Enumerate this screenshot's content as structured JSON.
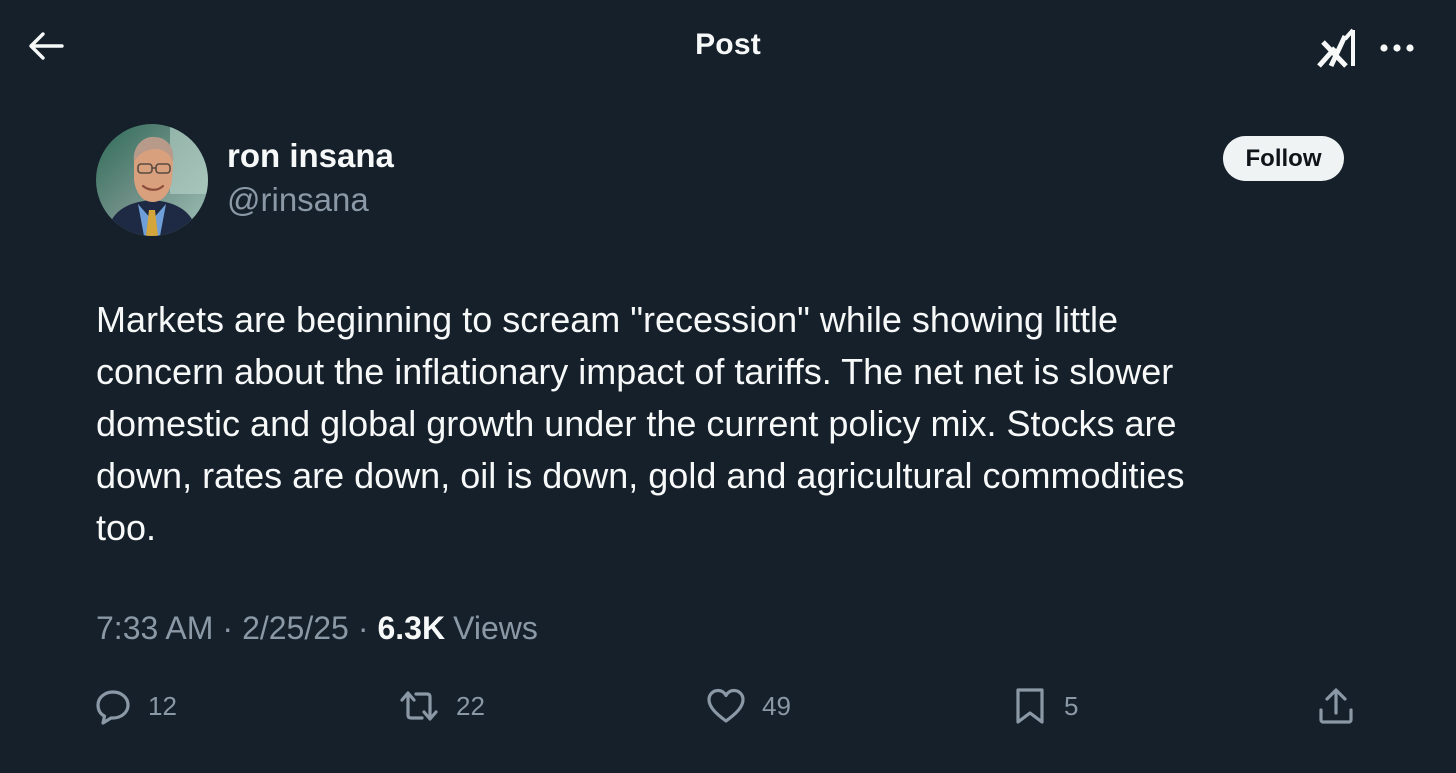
{
  "header": {
    "title": "Post",
    "back_icon": "arrow-left-icon",
    "grok_icon": "grok-logo-icon",
    "more_icon": "more-dots-icon"
  },
  "author": {
    "display_name": "ron insana",
    "handle": "@rinsana",
    "follow_label": "Follow"
  },
  "post": {
    "text": "Markets are beginning to scream \"recession\" while showing little\nconcern about the inflationary impact of tariffs. The net net is slower\ndomestic and global growth under the current policy mix. Stocks are\ndown, rates are down, oil is down, gold and agricultural commodities\ntoo."
  },
  "meta": {
    "time": "7:33 AM",
    "date": "2/25/25",
    "views_count": "6.3K",
    "views_label": "Views",
    "separator": "·"
  },
  "actions": {
    "replies": "12",
    "reposts": "22",
    "likes": "49",
    "bookmarks": "5"
  },
  "colors": {
    "background": "#15202b",
    "text_primary": "#f7f9f9",
    "text_secondary": "#8b98a5",
    "follow_bg": "#eff3f4"
  }
}
